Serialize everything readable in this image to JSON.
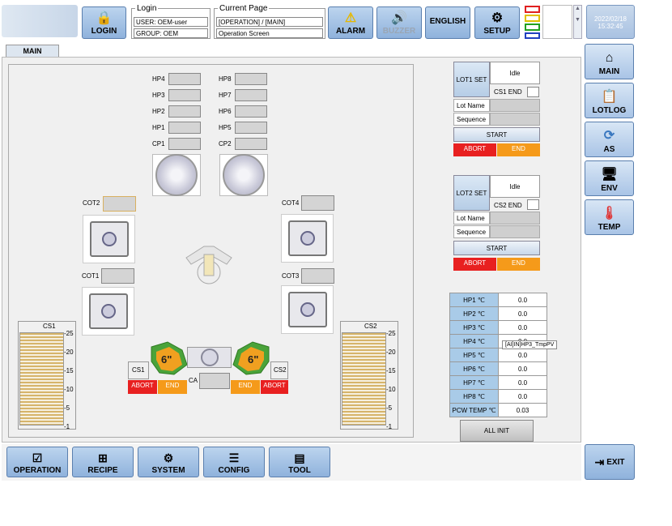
{
  "header": {
    "login_btn": "LOGIN",
    "login_legend": "Login",
    "user": "USER: OEM-user",
    "group": "GROUP: OEM",
    "page_legend": "Current Page",
    "page_path": "[OPERATION] / [MAIN]",
    "page_name": "Operation Screen",
    "alarm": "ALARM",
    "buzzer": "BUZZER",
    "english": "ENGLISH",
    "setup": "SETUP",
    "date": "2022/02/18",
    "time": "15:32:45"
  },
  "tab": "MAIN",
  "hp_left": [
    "HP4",
    "HP3",
    "HP2",
    "HP1",
    "CP1"
  ],
  "hp_right": [
    "HP8",
    "HP7",
    "HP6",
    "HP5",
    "CP2"
  ],
  "cot": {
    "cot1": "COT1",
    "cot2": "COT2",
    "cot3": "COT3",
    "cot4": "COT4"
  },
  "cs": {
    "cs1": "CS1",
    "cs2": "CS2",
    "ticks": [
      "-25",
      "-20",
      "-15",
      "-10",
      "-5",
      "-1"
    ],
    "small1": "CS1",
    "small2": "CS2",
    "ca": "CA",
    "abort": "ABORT",
    "end": "END",
    "size": "6\""
  },
  "lot1": {
    "set": "LOT1 SET",
    "status": "Idle",
    "end_label": "CS1 END",
    "lot_name": "Lot Name",
    "sequence": "Sequence",
    "start": "START",
    "abort": "ABORT",
    "end": "END"
  },
  "lot2": {
    "set": "LOT2 SET",
    "status": "Idle",
    "end_label": "CS2 END",
    "lot_name": "Lot Name",
    "sequence": "Sequence",
    "start": "START",
    "abort": "ABORT",
    "end": "END"
  },
  "temps": [
    {
      "label": "HP1 ℃",
      "value": "0.0"
    },
    {
      "label": "HP2 ℃",
      "value": "0.0"
    },
    {
      "label": "HP3 ℃",
      "value": "0.0"
    },
    {
      "label": "HP4 ℃",
      "value": "0.0"
    },
    {
      "label": "HP5 ℃",
      "value": "0.0"
    },
    {
      "label": "HP6 ℃",
      "value": "0.0"
    },
    {
      "label": "HP7 ℃",
      "value": "0.0"
    },
    {
      "label": "HP8 ℃",
      "value": "0.0"
    },
    {
      "label": "PCW TEMP ℃",
      "value": "0.03"
    }
  ],
  "tooltip": "[AI]IN]HP3_TmpPV",
  "all_init": "ALL INIT",
  "side": [
    "MAIN",
    "LOTLOG",
    "AS",
    "ENV",
    "TEMP"
  ],
  "bottom": [
    "OPERATION",
    "RECIPE",
    "SYSTEM",
    "CONFIG",
    "TOOL"
  ],
  "exit": "EXIT",
  "colors": {
    "accent": "#8fb2dc",
    "abort": "#e82020",
    "end": "#f59a1a",
    "hp_label": "#a9cbe8"
  }
}
